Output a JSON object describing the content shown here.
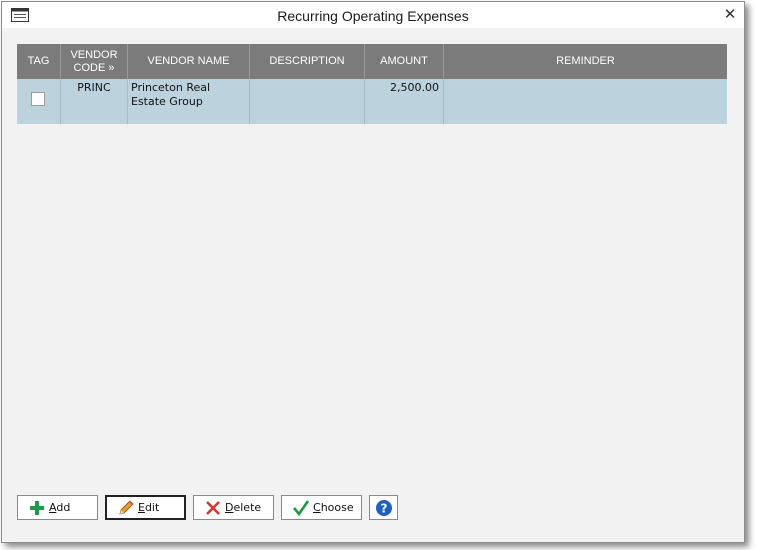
{
  "window": {
    "title": "Recurring Operating Expenses"
  },
  "grid": {
    "columns": [
      {
        "key": "tag",
        "label": "TAG"
      },
      {
        "key": "vendor_code",
        "label": "VENDOR\nCODE »"
      },
      {
        "key": "vendor_name",
        "label": "VENDOR NAME"
      },
      {
        "key": "description",
        "label": "DESCRIPTION"
      },
      {
        "key": "amount",
        "label": "AMOUNT"
      },
      {
        "key": "reminder",
        "label": "REMINDER"
      }
    ],
    "rows": [
      {
        "tagged": false,
        "vendor_code": "PRINC",
        "vendor_name": "Princeton Real Estate Group",
        "description": "",
        "amount": "2,500.00",
        "reminder": ""
      }
    ]
  },
  "buttons": {
    "add": {
      "first": "A",
      "rest": "dd"
    },
    "edit": {
      "first": "E",
      "rest": "dit"
    },
    "delete": {
      "first": "D",
      "rest": "elete"
    },
    "choose": {
      "first": "C",
      "rest": "hoose"
    }
  },
  "colors": {
    "header_bg": "#7b7b7b",
    "row_selected_bg": "#bcd3de",
    "add_icon": "#1a9a4a",
    "delete_icon": "#d6342c",
    "choose_icon": "#1f9a3a",
    "help_icon": "#1f5fbf"
  }
}
